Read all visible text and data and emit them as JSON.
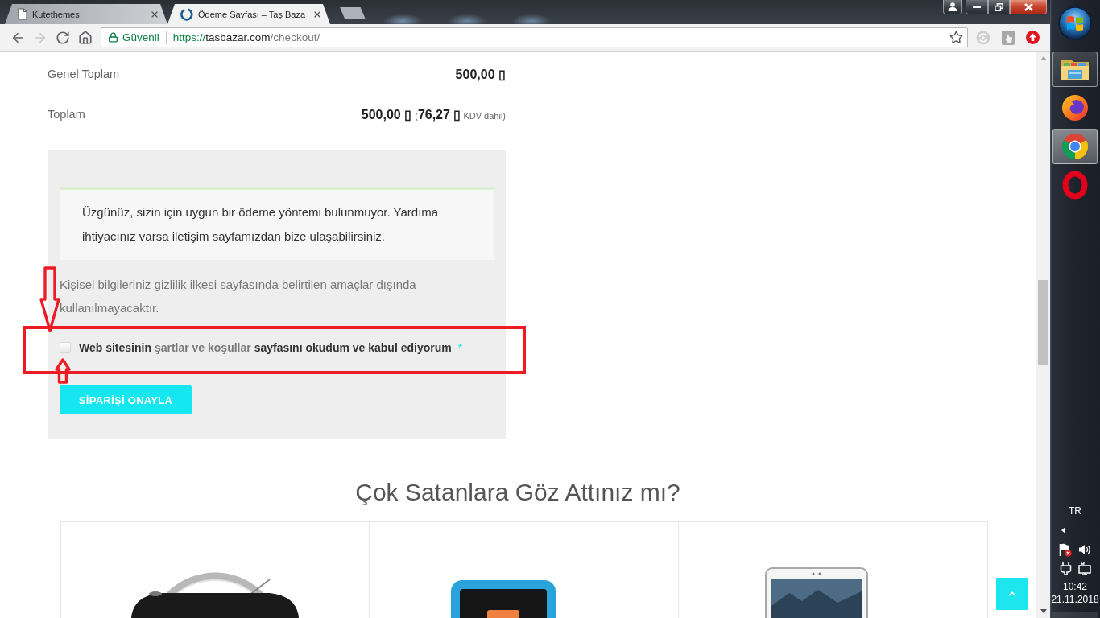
{
  "browser": {
    "tabs": [
      {
        "kind": "page",
        "title": "Kutethemes",
        "selected": false
      },
      {
        "kind": "ring",
        "title": "Ödeme Sayfası – Taş Baza",
        "selected": true
      }
    ],
    "nav": [
      {
        "kind": "back",
        "disabled": false
      },
      {
        "kind": "forward",
        "disabled": true
      },
      {
        "kind": "reload",
        "disabled": false
      },
      {
        "kind": "home",
        "disabled": false
      }
    ],
    "address": {
      "security_label": "Güvenli",
      "scheme": "https://",
      "host": "tasbazar.com",
      "path": "/checkout/",
      "bookmarked": false
    }
  },
  "page": {
    "summary": [
      {
        "label": "Genel Toplam",
        "amount": "500,00 ▯"
      },
      {
        "label": "Toplam",
        "amount": "500,00 ▯",
        "tax_note": "(**76,27 ▯** KDV dahil)"
      }
    ],
    "payment_notice": "Üzgünüz, sizin için uygun bir ödeme yöntemi bulunmuyor. Yardıma ihtiyacınız varsa iletişim sayfamızdan bize ulaşabilirsiniz.",
    "privacy_text": "Kişisel bilgileriniz gizlilik ilkesi sayfasında belirtilen amaçlar dışında kullanılmayacaktır.",
    "terms": {
      "checked": false,
      "text_before": "Web sitesinin",
      "link": "şartlar ve koşullar",
      "text_after": "sayfasını okudum ve kabul ediyorum",
      "required_mark": "*"
    },
    "submit_button": "SİPARİŞİ ONAYLA",
    "bestsellers": {
      "title": "Çok Satanlara Göz Attınız mı?",
      "products": [
        {
          "kind": "radio"
        },
        {
          "kind": "tablet_case"
        },
        {
          "kind": "tablet"
        }
      ]
    }
  },
  "annotations": [
    {
      "kind": "arrow_down"
    },
    {
      "kind": "frame"
    },
    {
      "kind": "arrow_up"
    }
  ],
  "taskbar": {
    "apps": [
      {
        "kind": "folder",
        "running": true,
        "selected": false
      },
      {
        "kind": "fox",
        "running": false,
        "selected": false
      },
      {
        "kind": "wheel",
        "running": true,
        "selected": true
      },
      {
        "kind": "ring",
        "running": false,
        "selected": false
      }
    ],
    "tray": {
      "language": "TR",
      "time": "10:42",
      "date": "21.11.2018"
    }
  }
}
